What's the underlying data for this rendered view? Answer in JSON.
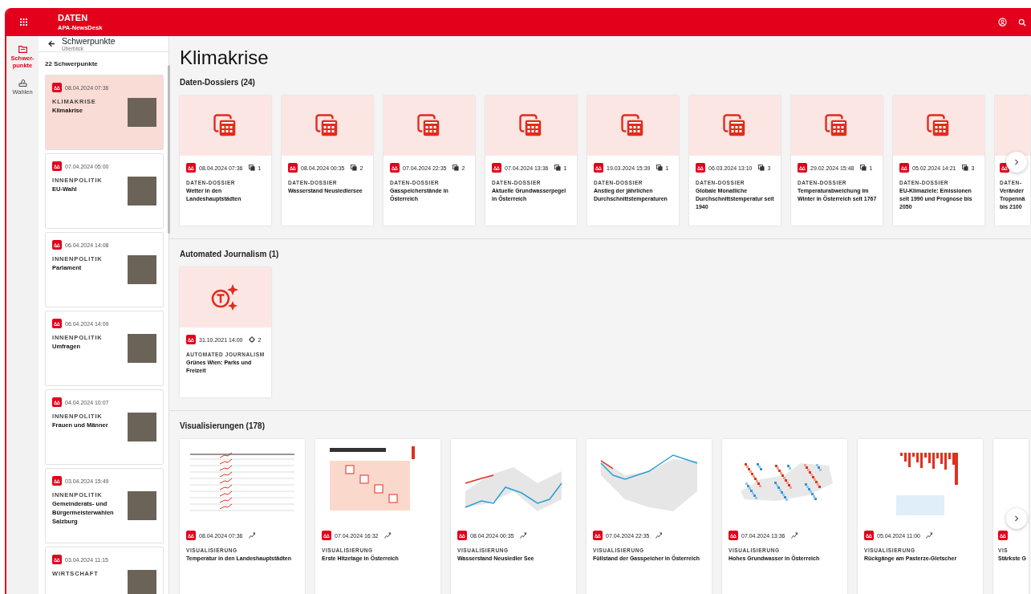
{
  "app_bar": {
    "title": "DATEN",
    "subtitle": "APA-NewsDesk"
  },
  "rail": [
    {
      "kind": "folder",
      "label": "Schwer-\npunkte",
      "selected": true
    },
    {
      "kind": "ballot",
      "label": "Wahlen",
      "selected": false
    }
  ],
  "panel": {
    "title": "Schwerpunkte",
    "subtitle": "Überblick",
    "count": "22 Schwerpunkte",
    "items": [
      {
        "date": "08.04.2024 07:36",
        "category": "KLIMAKRISE",
        "title": "Klimakrise",
        "selected": true
      },
      {
        "date": "07.04.2024 05:00",
        "category": "INNENPOLITIK",
        "title": "EU-Wahl",
        "selected": false
      },
      {
        "date": "06.04.2024 14:08",
        "category": "INNENPOLITIK",
        "title": "Parlament",
        "selected": false
      },
      {
        "date": "06.04.2024 14:09",
        "category": "INNENPOLITIK",
        "title": "Umfragen",
        "selected": false
      },
      {
        "date": "04.04.2024 10:07",
        "category": "INNENPOLITIK",
        "title": "Frauen und Männer",
        "selected": false
      },
      {
        "date": "03.04.2024 15:49",
        "category": "INNENPOLITIK",
        "title": "Gemeinderats- und Bürgermeisterwahlen Salzburg",
        "selected": false
      },
      {
        "date": "03.04.2024 11:15",
        "category": "WIRTSCHAFT",
        "selected": false
      }
    ]
  },
  "page_title": "Klimakrise",
  "sections": [
    {
      "kind": "dossier",
      "heading": "Daten-Dossiers (24)",
      "next_button": true,
      "cards": [
        {
          "date": "08.04.2024 07:36",
          "count": "1",
          "category": "DATEN-DOSSIER",
          "title": "Wetter in den Landeshauptstädten"
        },
        {
          "date": "08.04.2024 00:35",
          "count": "2",
          "category": "DATEN-DOSSIER",
          "title": "Wasserstand Neusiedlersee"
        },
        {
          "date": "07.04.2024 22:35",
          "count": "2",
          "category": "DATEN-DOSSIER",
          "title": "Gasspeicherstände in Österreich"
        },
        {
          "date": "07.04.2024 13:36",
          "count": "1",
          "category": "DATEN-DOSSIER",
          "title": "Aktuelle Grundwasserpegel in Österreich"
        },
        {
          "date": "19.03.2024 15:39",
          "count": "1",
          "category": "DATEN-DOSSIER",
          "title": "Anstieg der jährlichen Durchschnittstemperaturen"
        },
        {
          "date": "06.03.2024 13:10",
          "count": "3",
          "category": "DATEN-DOSSIER",
          "title": "Globale Monatliche Durchschnittstemperatur seit 1940"
        },
        {
          "date": "29.02.2024 15:48",
          "count": "1",
          "category": "DATEN-DOSSIER",
          "title": "Temperaturabweichung im Winter in Österreich seit 1767"
        },
        {
          "date": "05.02.2024 14:21",
          "count": "3",
          "category": "DATEN-DOSSIER",
          "title": "EU-Klimaziele: Emissionen seit 1990 und Prognose bis 2050"
        },
        {
          "partial": true,
          "category": "DATEN-",
          "title": "Veränder\nTropennä\nbis 2100"
        }
      ]
    },
    {
      "kind": "automated",
      "heading": "Automated Journalism (1)",
      "next_button": false,
      "cards": [
        {
          "date": "31.10.2021 14:00",
          "count": "2",
          "category": "AUTOMATED JOURNALISM",
          "title": "Grünes Wien: Parks und Freizeit"
        }
      ]
    },
    {
      "kind": "visual",
      "heading": "Visualisierungen (178)",
      "next_button": true,
      "cards": [
        {
          "kind": "table",
          "date": "08.04.2024 07:36",
          "category": "VISUALISIERUNG",
          "title": "Temperatur in den Landeshauptstädten"
        },
        {
          "kind": "calendar",
          "date": "07.04.2024 16:32",
          "category": "VISUALISIERUNG",
          "title": "Erste Hitzetage in Österreich"
        },
        {
          "kind": "line",
          "date": "08.04.2024 00:35",
          "category": "VISUALISIERUNG",
          "title": "Wasserstand Neusiedler See"
        },
        {
          "kind": "band",
          "date": "07.04.2024 22:35",
          "category": "VISUALISIERUNG",
          "title": "Füllstand der Gasspeicher in Österreich"
        },
        {
          "kind": "map",
          "date": "07.04.2024 13:36",
          "category": "VISUALISIERUNG",
          "title": "Hohes Grundwasser in Österreich"
        },
        {
          "kind": "bars",
          "date": "05.04.2024 11:00",
          "category": "VISUALISIERUNG",
          "title": "Rückgänge am Pasterze-Gletscher"
        },
        {
          "partial": true,
          "category": "VIS",
          "title": "Stärkste G"
        }
      ]
    }
  ]
}
